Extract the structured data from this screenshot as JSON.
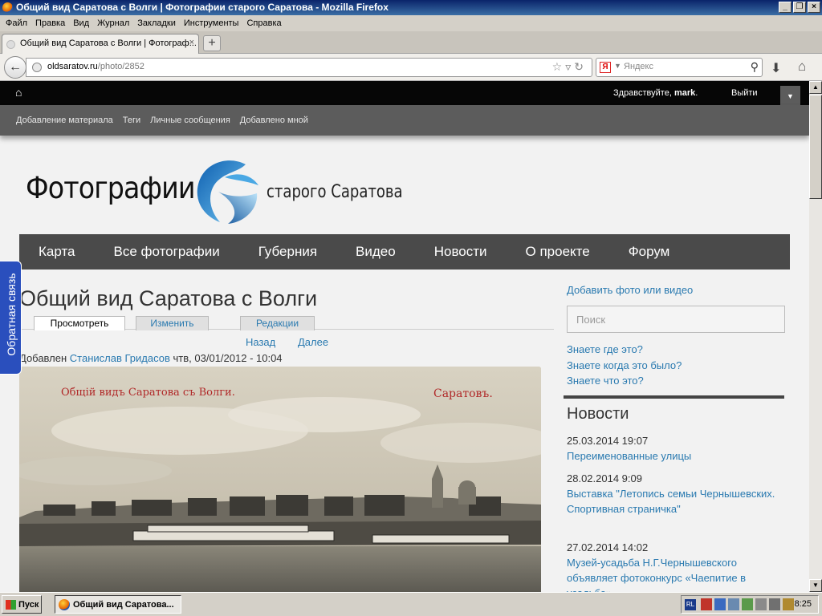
{
  "window": {
    "title": "Общий вид Саратова с Волги | Фотографии старого Саратова - Mozilla Firefox"
  },
  "menu": [
    "Файл",
    "Правка",
    "Вид",
    "Журнал",
    "Закладки",
    "Инструменты",
    "Справка"
  ],
  "tab": {
    "label": "Общий вид Саратова с Волги | Фотограф...",
    "close": "×",
    "new": "+"
  },
  "address": {
    "host": "oldsaratov.ru",
    "path": "/photo/2852"
  },
  "search": {
    "engine": "Я",
    "placeholder": "Яндекс"
  },
  "site": {
    "greeting": "Здравствуйте,",
    "user": "mark",
    "logout": "Выйти",
    "subnav": [
      "Добавление материала",
      "Теги",
      "Личные сообщения",
      "Добавлено мной"
    ],
    "logo_left": "Фотографии",
    "logo_right": "старого Саратова",
    "mainnav": [
      "Карта",
      "Все фотографии",
      "Губерния",
      "Видео",
      "Новости",
      "О проекте",
      "Форум"
    ],
    "feedback": "Обратная связь"
  },
  "article": {
    "title": "Общий вид Саратова с Волги",
    "tabs": [
      "Просмотреть",
      "Изменить",
      "Редакции"
    ],
    "prev": "Назад",
    "next": "Далее",
    "added_prefix": "Добавлен",
    "author": "Станислав Гридасов",
    "date": "чтв, 03/01/2012 - 10:04",
    "photo_caption_left": "Общій видъ Саратова съ Волги.",
    "photo_caption_right": "Саратовъ."
  },
  "sidebar": {
    "add_link": "Добавить фото или видео",
    "search_placeholder": "Поиск",
    "quiz": [
      "Знаете где это?",
      "Знаете когда это было?",
      "Знаете что это?"
    ],
    "news_heading": "Новости",
    "news": [
      {
        "date": "25.03.2014 19:07",
        "title": "Переименованные улицы"
      },
      {
        "date": "28.02.2014 9:09",
        "title": "Выставка \"Летопись семьи Чернышевских. Спортивная страничка\""
      },
      {
        "date": "27.02.2014 14:02",
        "title": "Музей-усадьба Н.Г.Чернышевского объявляет фотоконкурс «Чаепитие в усадьбе»"
      }
    ]
  },
  "taskbar": {
    "start": "Пуск",
    "item": "Общий вид Саратова...",
    "lang": "RL",
    "clock": "8:25"
  },
  "colors": {
    "link": "#2a7ab0",
    "nav": "#4a4a4a",
    "feedback": "#2a4fbd"
  }
}
